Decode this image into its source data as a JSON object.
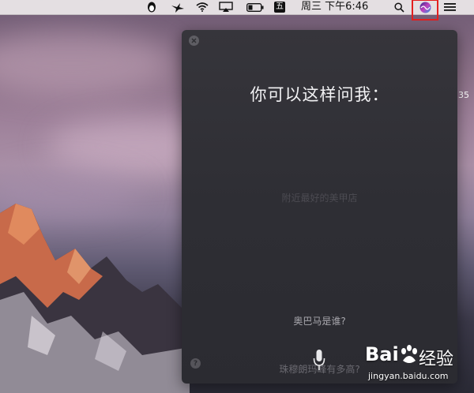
{
  "menubar": {
    "icons": [
      "qq-penguin-icon",
      "bird-icon",
      "wifi-icon",
      "airplay-icon",
      "battery-icon",
      "wubi-input-icon",
      "spotlight-search-icon",
      "siri-icon",
      "notification-center-icon"
    ],
    "input_method_label": "五",
    "clock": "周三 下午6:46"
  },
  "desktop": {
    "edge_text": "35"
  },
  "siri": {
    "prompt_title": "你可以这样问我：",
    "suggestions": [
      "附近最好的美甲店",
      "奥巴马是谁?",
      "珠穆朗玛峰有多高?"
    ],
    "help_label": "?"
  },
  "watermark": {
    "brand": "Bai",
    "brand_suffix": "经验",
    "url": "jingyan.baidu.com"
  },
  "colors": {
    "highlight": "#e32020",
    "panel_bg": "#303036"
  }
}
